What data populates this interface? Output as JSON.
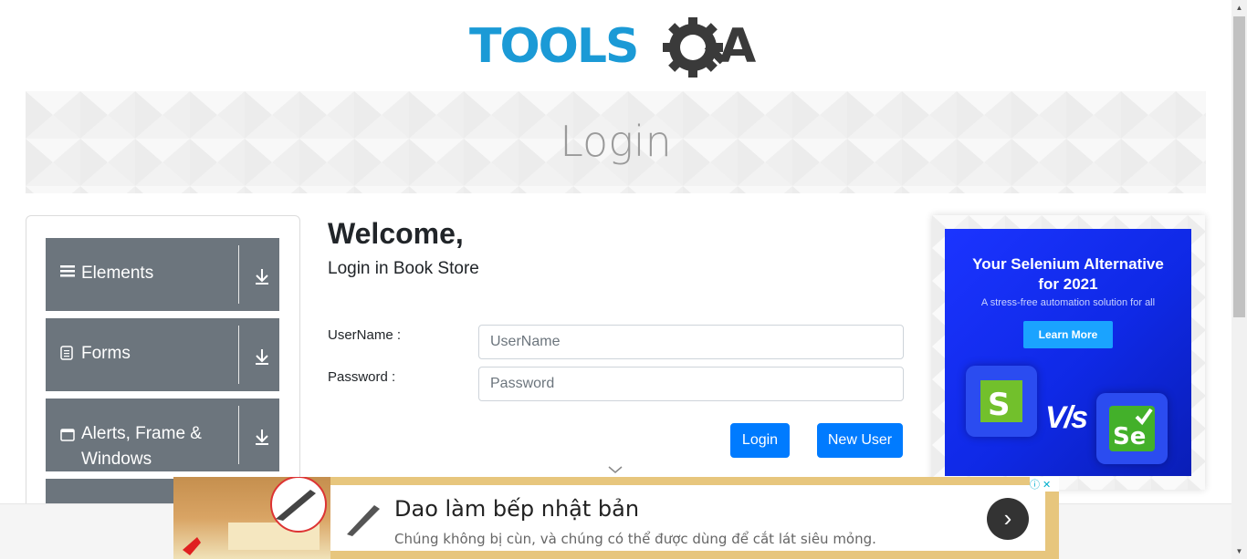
{
  "header": {
    "logo_alt": "TOOLSQA",
    "logo_tools": "TOOLS",
    "logo_a": "A"
  },
  "banner": {
    "title": "Login"
  },
  "sidebar": {
    "groups": [
      {
        "label": "Elements",
        "icon": "list-icon"
      },
      {
        "label": "Forms",
        "icon": "document-icon"
      },
      {
        "label": "Alerts, Frame &",
        "label2": "Windows",
        "icon": "window-icon"
      }
    ]
  },
  "form": {
    "welcome": "Welcome,",
    "subtitle": "Login in Book Store",
    "username_label": "UserName :",
    "username_placeholder": "UserName",
    "password_label": "Password :",
    "password_placeholder": "Password",
    "login_button": "Login",
    "new_user_button": "New User"
  },
  "right_ad": {
    "headline_1": "Your Selenium Alternative",
    "headline_2": "for 2021",
    "subtext": "A stress-free automation solution for all",
    "cta": "Learn More",
    "vs": "V/s",
    "se": "Se"
  },
  "bottom_ad": {
    "title": "Dao làm bếp nhật bản",
    "description": "Chúng không bị cùn, và chúng có thể được dùng để cắt lát siêu mỏng.",
    "go": "›",
    "info": "ⓘ ✕"
  },
  "colors": {
    "accent": "#007bff",
    "sidebar": "#6c757d",
    "logo_blue": "#1b9ad6",
    "logo_dark": "#3a3a3a"
  }
}
